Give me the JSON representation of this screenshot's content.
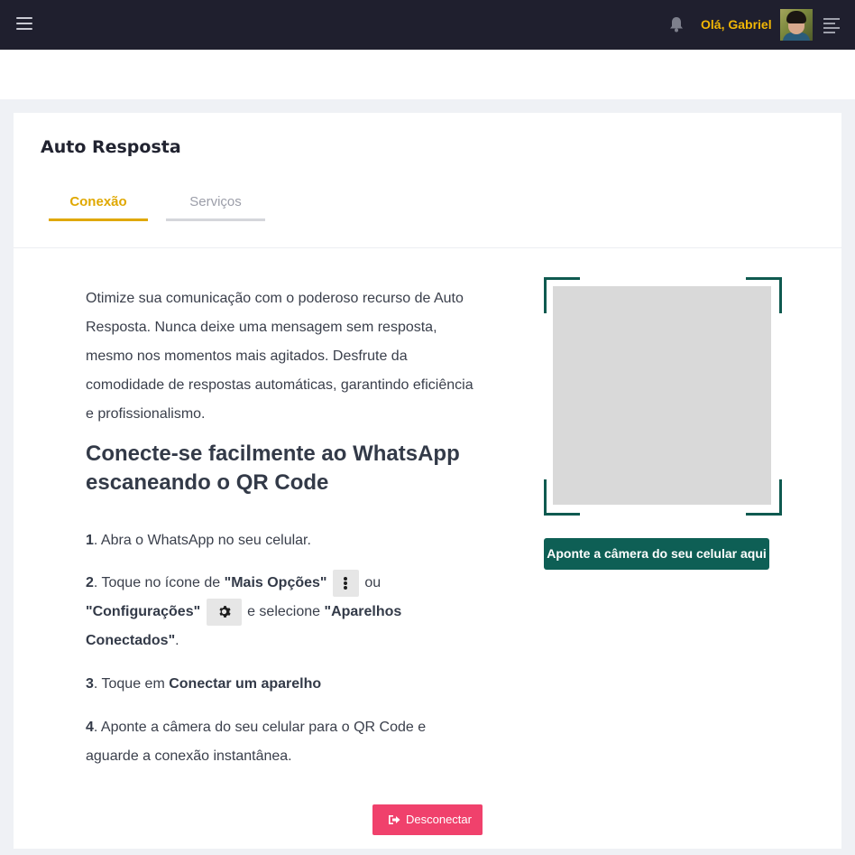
{
  "topbar": {
    "menu_icon": "hamburger-icon",
    "notification_icon": "bell-icon",
    "greeting": "Olá, Gabriel",
    "avatar_icon": "user-avatar",
    "right_menu_icon": "align-right-menu-icon",
    "accent_color": "#f2b705",
    "background_color": "#1f1f2e"
  },
  "page": {
    "title": "Auto Resposta",
    "tabs": [
      {
        "label": "Conexão",
        "active": true
      },
      {
        "label": "Serviços",
        "active": false
      }
    ]
  },
  "content": {
    "intro": "Otimize sua comunicação com o poderoso recurso de Auto Resposta. Nunca deixe uma mensagem sem resposta, mesmo nos momentos mais agitados. Desfrute da comodidade de respostas automáticas, garantindo eficiência e profissionalismo.",
    "headline": "Conecte-se facilmente ao WhatsApp escaneando o QR Code",
    "steps": {
      "s1": {
        "num": "1",
        "text": ". Abra o WhatsApp no seu celular."
      },
      "s2": {
        "num": "2",
        "t1": ". Toque no ícone de ",
        "b1": "\"Mais Opções\"",
        "t2": " ou",
        "b2": "\"Configurações\"",
        "t3": " e selecione ",
        "b3": "\"Aparelhos Conectados\"",
        "t4": "."
      },
      "s3": {
        "num": "3",
        "t1": ". Toque em ",
        "b1": "Conectar um aparelho"
      },
      "s4": {
        "num": "4",
        "text": ". Aponte a câmera do seu celular para o QR Code e aguarde a conexão instantânea."
      }
    },
    "icons": {
      "more": "vertical-dots-icon",
      "settings": "gear-icon"
    }
  },
  "qr": {
    "placeholder_color": "#d9d9d9",
    "frame_color": "#0f5a50",
    "camera_button": "Aponte a câmera do seu celular aqui"
  },
  "actions": {
    "disconnect_label": "Desconectar",
    "disconnect_icon": "sign-out-icon",
    "disconnect_color": "#f0416c"
  }
}
